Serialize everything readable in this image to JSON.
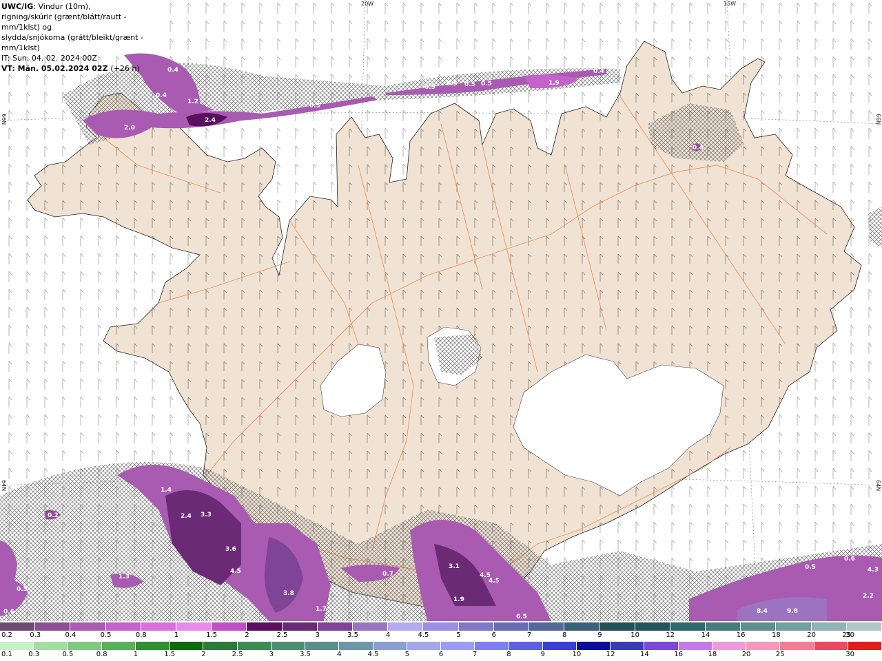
{
  "header": {
    "model": "UWC/IG",
    "line1_rest": ": Vindur (10m),",
    "line2": "rigning/skúrir (grænt/blátt/rautt - mm/1klst) og",
    "line3": "slydda/snjókoma (grátt/bleikt/grænt - mm/1klst)",
    "init_time": "IT: Sun. 04. 02. 2024 00Z",
    "valid_time": "VT: Mán. 05.02.2024 02Z",
    "lead_time": "(+26 h)"
  },
  "graticule": {
    "lon_labels": [
      "20W",
      "15W"
    ],
    "lat_labels": [
      "66N",
      "66N",
      "64N",
      "64N"
    ]
  },
  "precip_values": [
    "0.4",
    "1.2",
    "0.4",
    "2.0",
    "2.4",
    "0.5",
    "0.5",
    "0.5",
    "0.5",
    "1.9",
    "0.4",
    "0.5",
    "0.4",
    "1.4",
    "0.2",
    "2.4",
    "3.3",
    "3.6",
    "4.5",
    "3.8",
    "1.3",
    "0.5",
    "0.6",
    "1.7",
    "0.7",
    "3.1",
    "4.5",
    "4.5",
    "1.9",
    "6.5",
    "0.5",
    "0.6",
    "4.3",
    "2.2",
    "8.4",
    "9.8"
  ],
  "legend_snow": {
    "labels": [
      "0.2",
      "0.3",
      "0.4",
      "0.5",
      "0.8",
      "1",
      "1.5",
      "2",
      "2.5",
      "3",
      "3.5",
      "4",
      "4.5",
      "5",
      "6",
      "7",
      "8",
      "9",
      "10",
      "12",
      "14",
      "16",
      "18",
      "20",
      "25",
      "30"
    ],
    "colors": [
      "#6e4b73",
      "#8e4f95",
      "#a85bb0",
      "#c461cc",
      "#d970db",
      "#e88ae8",
      "#c14fc4",
      "#5b0f5f",
      "#6a2a76",
      "#7e4496",
      "#9b73c1",
      "#b3aaf0",
      "#9a8fe3",
      "#8278c9",
      "#6a6cb1",
      "#526a95",
      "#3b6178",
      "#234f56",
      "#23565a",
      "#2f6a6b",
      "#467c7d",
      "#5d8f8f",
      "#73a0a0",
      "#8fb4b4",
      "#b2c8c8"
    ]
  },
  "legend_rain": {
    "labels": [
      "0.1",
      "0.3",
      "0.5",
      "0.8",
      "1",
      "1.5",
      "2",
      "2.5",
      "3",
      "3.5",
      "4",
      "4.5",
      "5",
      "6",
      "7",
      "8",
      "9",
      "10",
      "12",
      "14",
      "16",
      "18",
      "20",
      "25",
      "30"
    ],
    "colors": [
      "#c8f0c8",
      "#a4dca4",
      "#80c880",
      "#58b058",
      "#2e902e",
      "#0e6a0e",
      "#2e7a3a",
      "#3c8a55",
      "#4e8e73",
      "#5b8f8c",
      "#6d96a7",
      "#8a9fd0",
      "#a2a8e8",
      "#9d9cf4",
      "#7f7ef0",
      "#5e5ee4",
      "#3c3cd8",
      "#0c0c9e",
      "#3a3ab8",
      "#7a4ad6",
      "#c37ce6",
      "#ec9ad8",
      "#f39aba",
      "#f47d94",
      "#ee4760",
      "#e21d1d"
    ]
  }
}
